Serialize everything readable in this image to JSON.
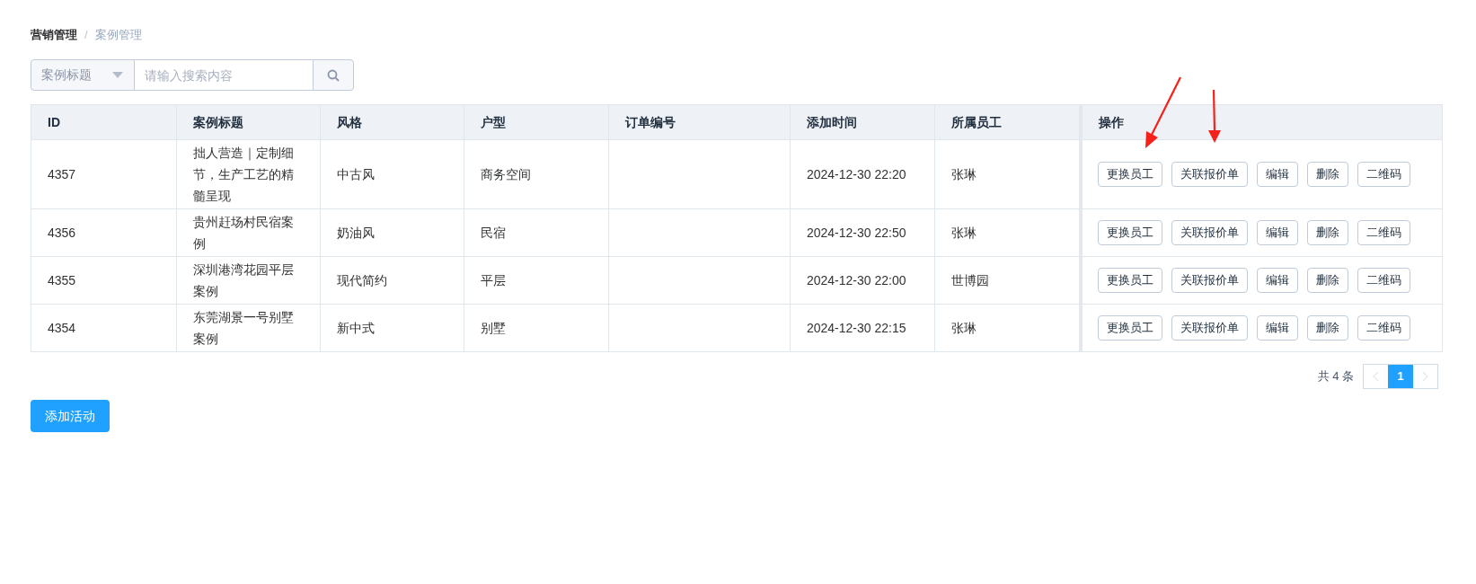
{
  "breadcrumb_separator": "/",
  "breadcrumb": [
    {
      "label": "营销管理",
      "current": false
    },
    {
      "label": "案例管理",
      "current": true
    }
  ],
  "search": {
    "field_select": "案例标题",
    "placeholder": "请输入搜索内容"
  },
  "table": {
    "columns": [
      "ID",
      "案例标题",
      "风格",
      "户型",
      "订单编号",
      "添加时间",
      "所属员工",
      "操作"
    ],
    "rows": [
      {
        "id": "4357",
        "title": "拙人营造｜定制细节，生产工艺的精髓呈现",
        "style": "中古风",
        "layout": "商务空间",
        "order_no": "",
        "added": "2024-12-30 22:20",
        "employee": "张琳",
        "actions": [
          "更换员工",
          "关联报价单",
          "编辑",
          "删除",
          "二维码"
        ]
      },
      {
        "id": "4356",
        "title": "贵州赶场村民宿案例",
        "style": "奶油风",
        "layout": "民宿",
        "order_no": "",
        "added": "2024-12-30 22:50",
        "employee": "张琳",
        "actions": [
          "更换员工",
          "关联报价单",
          "编辑",
          "删除",
          "二维码"
        ]
      },
      {
        "id": "4355",
        "title": "深圳港湾花园平层案例",
        "style": "现代简约",
        "layout": "平层",
        "order_no": "",
        "added": "2024-12-30 22:00",
        "employee": "世博园",
        "actions": [
          "更换员工",
          "关联报价单",
          "编辑",
          "删除",
          "二维码"
        ]
      },
      {
        "id": "4354",
        "title": "东莞湖景一号别墅案例",
        "style": "新中式",
        "layout": "别墅",
        "order_no": "",
        "added": "2024-12-30 22:15",
        "employee": "张琳",
        "actions": [
          "更换员工",
          "关联报价单",
          "编辑",
          "删除",
          "二维码"
        ]
      }
    ]
  },
  "pagination": {
    "total": "共 4 条",
    "pages": [
      {
        "label": "1",
        "selected": true
      }
    ]
  },
  "add_button": "添加活动"
}
